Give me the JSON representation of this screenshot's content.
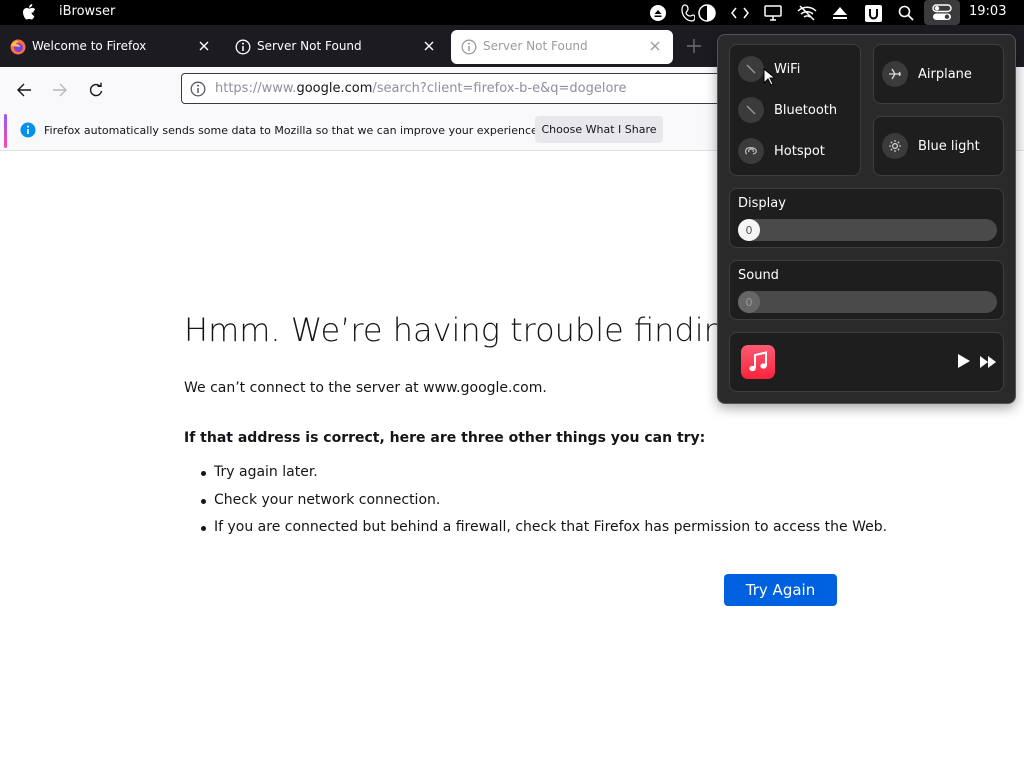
{
  "menubar": {
    "app_name": "iBrowser",
    "clock": "19:03",
    "icons": [
      "apple-icon",
      "eject-icon",
      "phone-icon",
      "contrast-icon",
      "code-icon",
      "display-icon",
      "wifi-off-icon",
      "upload-icon",
      "u-icon",
      "search-icon",
      "control-center-icon"
    ]
  },
  "tabs": [
    {
      "label": "Welcome to Firefox",
      "icon": "firefox-icon",
      "active": false
    },
    {
      "label": "Server Not Found",
      "icon": "info-icon",
      "active": false
    },
    {
      "label": "Server Not Found",
      "icon": "info-icon",
      "active": true
    }
  ],
  "urlbar": {
    "prefix": "https://www.",
    "domain": "google.com",
    "suffix": "/search?client=firefox-b-e&q=dogelore"
  },
  "notification": {
    "message": "Firefox automatically sends some data to Mozilla so that we can improve your experience.",
    "button_label": "Choose What I Share"
  },
  "error_page": {
    "title": "Hmm. We’re having trouble finding that site.",
    "description": "We can’t connect to the server at www.google.com.",
    "subtitle": "If that address is correct, here are three other things you can try:",
    "suggestions": [
      "Try again later.",
      "Check your network connection.",
      "If you are connected but behind a firewall, check that Firefox has permission to access the Web."
    ],
    "button_label": "Try Again"
  },
  "control_center": {
    "connectivity": [
      {
        "label": "WiFi",
        "icon": "wifi-off-icon"
      },
      {
        "label": "Bluetooth",
        "icon": "bluetooth-off-icon"
      },
      {
        "label": "Hotspot",
        "icon": "hotspot-icon"
      }
    ],
    "airplane_label": "Airplane",
    "bluelight_label": "Blue light",
    "display": {
      "label": "Display",
      "value": "0",
      "level": 0
    },
    "sound": {
      "label": "Sound",
      "value": "0",
      "level": 0
    },
    "music_app_icon": "music-icon"
  }
}
